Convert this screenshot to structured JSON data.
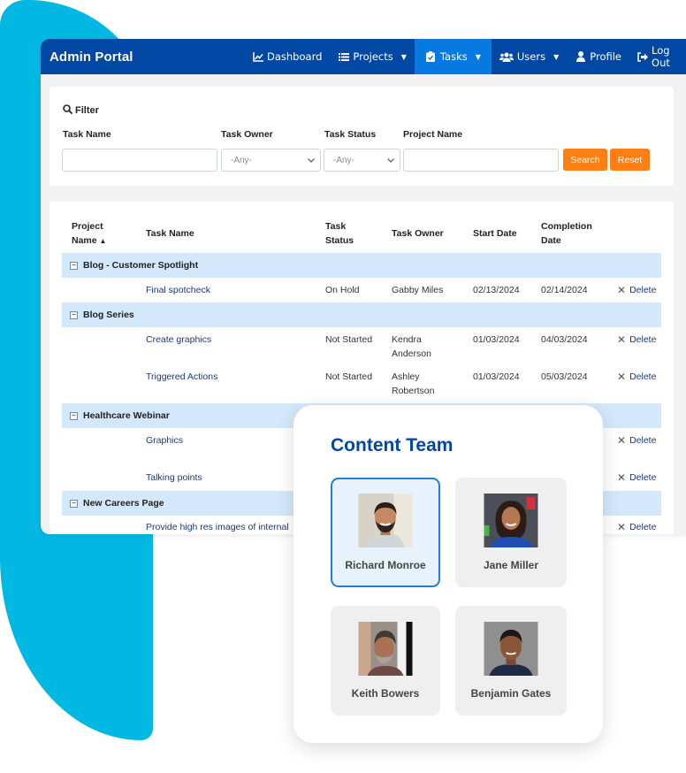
{
  "app": {
    "title": "Admin Portal",
    "nav": [
      {
        "label": "Dashboard",
        "icon": "chart-line-icon",
        "dropdown": false,
        "active": false
      },
      {
        "label": "Projects",
        "icon": "list-icon",
        "dropdown": true,
        "active": false
      },
      {
        "label": "Tasks",
        "icon": "clipboard-check-icon",
        "dropdown": true,
        "active": true
      },
      {
        "label": "Users",
        "icon": "users-icon",
        "dropdown": true,
        "active": false
      },
      {
        "label": "Profile",
        "icon": "user-icon",
        "dropdown": false,
        "active": false
      },
      {
        "label": "Log Out",
        "icon": "sign-out-icon",
        "dropdown": false,
        "active": false
      }
    ],
    "colors": {
      "navbar": "#0148a4",
      "nav_active": "#0879e0",
      "accent_orange": "#fd7e14",
      "group_row": "#d4e8fb",
      "backdrop": "#00b8e2"
    }
  },
  "filter": {
    "title": "Filter",
    "fields": {
      "task_name": {
        "label": "Task Name",
        "value": "",
        "placeholder": ""
      },
      "task_owner": {
        "label": "Task Owner",
        "selected": "-Any-"
      },
      "task_status": {
        "label": "Task Status",
        "selected": "-Any-"
      },
      "project_name": {
        "label": "Project Name",
        "value": "",
        "placeholder": ""
      }
    },
    "search_label": "Search",
    "reset_label": "Reset"
  },
  "table": {
    "columns": {
      "project_name": "Project Name",
      "project_name_line1": "Project",
      "project_name_line2": "Name",
      "sort_indicator": "▲",
      "task_name": "Task Name",
      "task_status_line1": "Task",
      "task_status_line2": "Status",
      "task_owner": "Task Owner",
      "start_date": "Start Date",
      "completion_line1": "Completion",
      "completion_line2": "Date"
    },
    "delete_label": "Delete",
    "groups": [
      {
        "project": "Blog - Customer Spotlight",
        "tasks": [
          {
            "task": "Final spotcheck",
            "status": "On Hold",
            "owner_line1": "Gabby Miles",
            "owner_line2": "",
            "start": "02/13/2024",
            "completion": "02/14/2024"
          }
        ]
      },
      {
        "project": "Blog Series",
        "tasks": [
          {
            "task": "Create graphics",
            "status": "Not Started",
            "owner_line1": "Kendra",
            "owner_line2": "Anderson",
            "start": "01/03/2024",
            "completion": "04/03/2024"
          },
          {
            "task": "Triggered Actions",
            "status": "Not Started",
            "owner_line1": "Ashley",
            "owner_line2": "Robertson",
            "start": "01/03/2024",
            "completion": "05/03/2024"
          }
        ]
      },
      {
        "project": "Healthcare Webinar",
        "tasks": [
          {
            "task": "Graphics"
          },
          {
            "task": "Talking points"
          }
        ]
      },
      {
        "project": "New Careers Page",
        "tasks": [
          {
            "task": "Provide high res images of internal"
          }
        ]
      }
    ]
  },
  "team": {
    "title": "Content Team",
    "members": [
      {
        "name": "Richard Monroe",
        "selected": true
      },
      {
        "name": "Jane Miller",
        "selected": false
      },
      {
        "name": "Keith Bowers",
        "selected": false
      },
      {
        "name": "Benjamin Gates",
        "selected": false
      }
    ]
  }
}
